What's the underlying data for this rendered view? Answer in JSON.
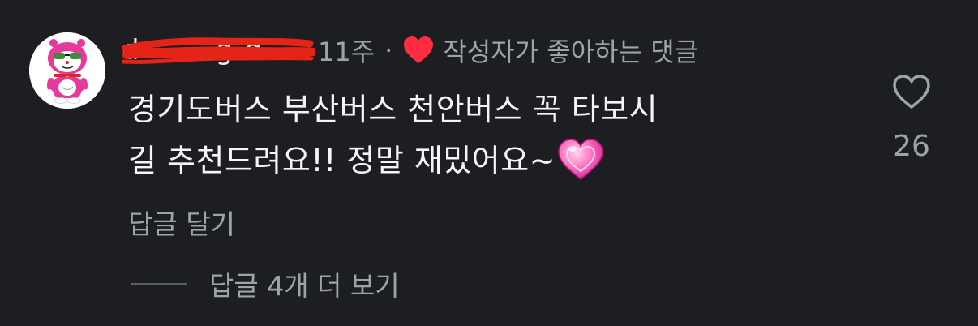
{
  "comment": {
    "username": "d-------g-d",
    "time": "11주",
    "separator": "·",
    "liked_by_author_label": "작성자가 좋아하는 댓글",
    "liked_by_author_icon": "red-heart-icon",
    "body_line1": "경기도버스 부산버스 천안버스 꼭 타보시",
    "body_line2": "길 추천드려요!! 정말 재밌어요~",
    "body_emoji": "pink-sparkle-heart-emoji",
    "reply_label": "답글 달기",
    "view_replies_label": "답글 4개 더 보기",
    "like_icon": "heart-outline-icon",
    "like_count": "26"
  },
  "colors": {
    "background": "#1c1e21",
    "primary_text": "#f5f5f5",
    "secondary_text": "#9ea3a8",
    "liked_heart": "#ff2d3f",
    "redaction": "#e32417",
    "avatar_character": "#e6399b"
  }
}
